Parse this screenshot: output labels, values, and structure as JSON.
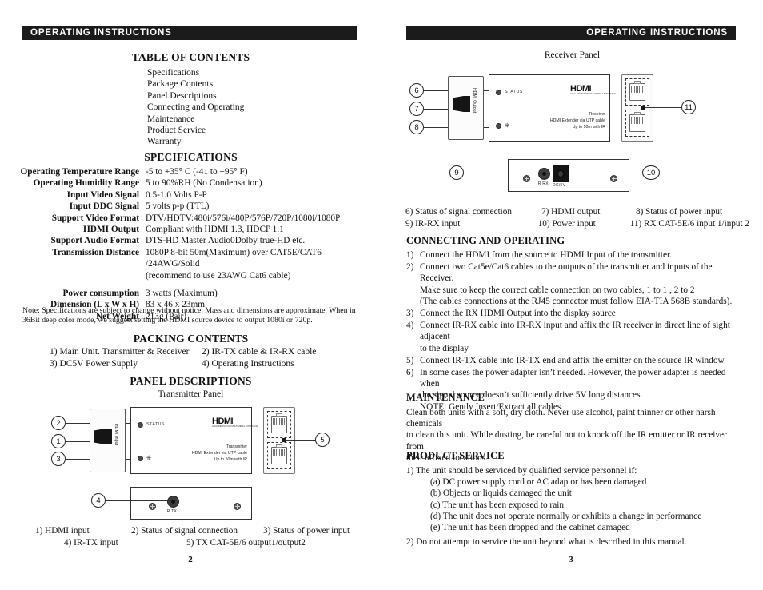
{
  "header": {
    "title": "OPERATING INSTRUCTIONS"
  },
  "left_page": {
    "page_number": "2",
    "toc": {
      "heading": "TABLE OF CONTENTS",
      "items": [
        "Specifications",
        "Package Contents",
        "Panel Descriptions",
        "Connecting and Operating",
        "Maintenance",
        "Product Service",
        "Warranty"
      ]
    },
    "specifications": {
      "heading": "SPECIFICATIONS",
      "rows": [
        {
          "key": "Operating Temperature Range",
          "value": "-5 to +35° C (-41 to +95° F)"
        },
        {
          "key": "Operating Humidity Range",
          "value": "5 to 90%RH (No Condensation)"
        },
        {
          "key": "Input Video Signal",
          "value": "0.5-1.0 Volts P-P"
        },
        {
          "key": "Input DDC Signal",
          "value": "5 volts p-p (TTL)"
        },
        {
          "key": "Support Video Format",
          "value": "DTV/HDTV:480i/576i/480P/576P/720P/1080i/1080P"
        },
        {
          "key": "HDMI Output",
          "value": "Compliant with HDMI 1.3, HDCP 1.1"
        },
        {
          "key": "Support Audio Format",
          "value": "DTS-HD Master Audio0Dolby true-HD etc."
        },
        {
          "key": "Transmission Distance",
          "value": "1080P 8-bit 50m(Maximum) over CAT5E/CAT6 /24AWG/Solid"
        },
        {
          "key": "",
          "value": "(recommend to use 23AWG Cat6 cable)"
        },
        {
          "key": "Power consumption",
          "value": "3 watts (Maximum)"
        },
        {
          "key": "Dimension (L x W x H)",
          "value": "83 x 46 x 23mm"
        },
        {
          "key": "Net Weight",
          "value": "213g (Pair)"
        }
      ],
      "note": "Note: Specifications are subject to change without notice. Mass and dimensions are approximate. When in 36Bit deep color mode, we suggest setting the HDMI source device to output 1080i or 720p."
    },
    "packing": {
      "heading": "PACKING CONTENTS",
      "items": [
        "1) Main Unit. Transmitter & Receiver",
        "2) IR-TX cable & IR-RX cable",
        "3) DC5V Power Supply",
        "4) Operating Instructions"
      ]
    },
    "panel": {
      "heading": "PANEL DESCRIPTIONS",
      "subheading": "Transmitter Panel",
      "unit_label_lines": [
        "Transmitter",
        "HDMI Extender via UTP cable",
        "Up to 50m with IR"
      ],
      "hdmi_logo": "HDMI",
      "hdmi_logo_sub": "HIGH-DEFINITION MULTIMEDIA INTERFACE",
      "status_label": "STATUS",
      "hdmi_port_label": "HDMI Input",
      "ir_port_label": "IR TX",
      "callout_numbers": [
        "1",
        "2",
        "3",
        "4",
        "5"
      ],
      "legend": [
        "1) HDMI input",
        "2) Status of signal connection",
        "3) Status of power input",
        "4) IR-TX input",
        "5) TX CAT-5E/6 output1/output2"
      ]
    }
  },
  "right_page": {
    "page_number": "3",
    "panel": {
      "subheading": "Receiver Panel",
      "unit_label_lines": [
        "Receiver",
        "HDMI Extender via UTP cable",
        "Up to 50m with IR"
      ],
      "hdmi_logo": "HDMI",
      "hdmi_logo_sub": "HIGH-DEFINITION MULTIMEDIA INTERFACE",
      "status_label": "STATUS",
      "hdmi_port_label": "HDMI Output",
      "ir_port_label": "IR RX",
      "dc_port_label": "DC/5V",
      "callout_numbers": [
        "6",
        "7",
        "8",
        "9",
        "10",
        "11"
      ],
      "legend": [
        "6) Status of signal connection",
        "7) HDMI output",
        "8) Status of power input",
        "9) IR-RX input",
        "10) Power input",
        "11) RX CAT-5E/6 input 1/input 2"
      ]
    },
    "connecting": {
      "heading": "CONNECTING AND OPERATING",
      "items": [
        {
          "n": "1)",
          "lines": [
            "Connect the HDMI from the source to HDMI Input of the transmitter."
          ]
        },
        {
          "n": "2)",
          "lines": [
            "Connect two Cat5e/Cat6 cables to the outputs of the transmitter and inputs of the Receiver.",
            "Make sure to keep the correct cable connection on two cables, 1 to 1 , 2 to 2",
            "(The cables connections at the RJ45 connector must follow EIA-TIA 568B standards)."
          ]
        },
        {
          "n": "3)",
          "lines": [
            "Connect the RX HDMI Output into the display source"
          ]
        },
        {
          "n": "4)",
          "lines": [
            "Connect IR-RX cable into IR-RX input and affix the IR receiver in direct line of sight adjacent",
            "to the display"
          ]
        },
        {
          "n": "5)",
          "lines": [
            "Connect IR-TX cable into IR-TX end and affix the emitter on the source IR window"
          ]
        },
        {
          "n": "6)",
          "lines": [
            "In some cases the power adapter isn’t needed. However, the power adapter is needed when",
            "the signal source doesn’t sufficiently drive 5V long distances.",
            "NOTE: Gently Insert/Extract all cables."
          ]
        }
      ]
    },
    "maintenance": {
      "heading": "MAINTENANCE",
      "lines": [
        "Clean both units with a soft, dry cloth. Never use alcohol, paint thinner or other harsh chemicals",
        "to clean this unit. While dusting, be careful not to knock off the IR emitter or IR receiver from",
        "their affixed locations."
      ]
    },
    "product_service": {
      "heading": "PRODUCT SERVICE",
      "item1": "1)  The unit should be serviced by qualified service personnel if:",
      "subitems": [
        "(a) DC power supply cord or AC adaptor has been damaged",
        "(b) Objects or liquids damaged the unit",
        "(c) The unit has been exposed to rain",
        "(d) The unit does not operate normally or exhibits a change in performance",
        "(e) The unit has been dropped and the cabinet damaged"
      ],
      "item2": "2)  Do not attempt to service the unit beyond what is described in this manual."
    }
  }
}
